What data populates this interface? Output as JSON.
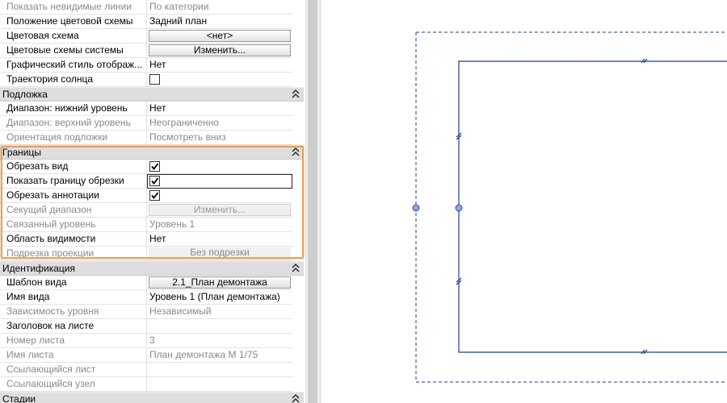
{
  "properties": {
    "rows": [
      {
        "label": "Показать невидимые линии",
        "value": "По категории",
        "dim": true
      },
      {
        "label": "Положение цветовой схемы",
        "value": "Задний план"
      },
      {
        "label": "Цветовая схема",
        "button": "<нет>"
      },
      {
        "label": "Цветовые схемы системы",
        "button": "Изменить..."
      },
      {
        "label": "Графический стиль отображ...",
        "value": "Нет"
      },
      {
        "label": "Траектория солнца",
        "checkbox": false
      }
    ],
    "group_underlay": "Подложка",
    "underlay_rows": [
      {
        "label": "Диапазон: нижний уровень",
        "value": "Нет"
      },
      {
        "label": "Диапазон: верхний уровень",
        "value": "Неограниченно",
        "dim": true
      },
      {
        "label": "Ориентация подложки",
        "value": "Посмотреть вниз",
        "dim": true
      }
    ],
    "group_extents": "Границы",
    "extents_rows": [
      {
        "label": "Обрезать вид",
        "checkbox": true
      },
      {
        "label": "Показать границу обрезки",
        "checkbox": true
      },
      {
        "label": "Обрезать аннотации",
        "checkbox": true
      },
      {
        "label": "Секущий диапазон",
        "button": "Изменить...",
        "dim": true
      },
      {
        "label": "Связанный уровень",
        "value": "Уровень 1",
        "dim": true
      },
      {
        "label": "Область видимости",
        "value": "Нет"
      },
      {
        "label": "Подрезка проекции",
        "button": "Без подрезки",
        "dim": true
      }
    ],
    "group_identity": "Идентификация",
    "identity_rows": [
      {
        "label": "Шаблон вида",
        "button": "2.1_План демонтажа"
      },
      {
        "label": "Имя вида",
        "value": "Уровень 1 (План демонтажа)"
      },
      {
        "label": "Зависимость уровня",
        "value": "Независимый",
        "dim": true
      },
      {
        "label": "Заголовок на листе",
        "value": ""
      },
      {
        "label": "Номер листа",
        "value": "3",
        "dim": true
      },
      {
        "label": "Имя листа",
        "value": "План демонтажа М 1/75",
        "dim": true
      },
      {
        "label": "Ссылающийся лист",
        "value": "",
        "dim": true
      },
      {
        "label": "Ссылающийся узел",
        "value": "",
        "dim": true
      }
    ],
    "group_phases": "Стадии"
  },
  "colors": {
    "accent_highlight": "#e8a05a",
    "crop_line": "#1f3f8f",
    "dashed_line": "#1f3f8f",
    "grip": "#8aa8d8"
  },
  "icons": {
    "collapse": "double-chevron-up-icon",
    "check": "check-icon"
  }
}
